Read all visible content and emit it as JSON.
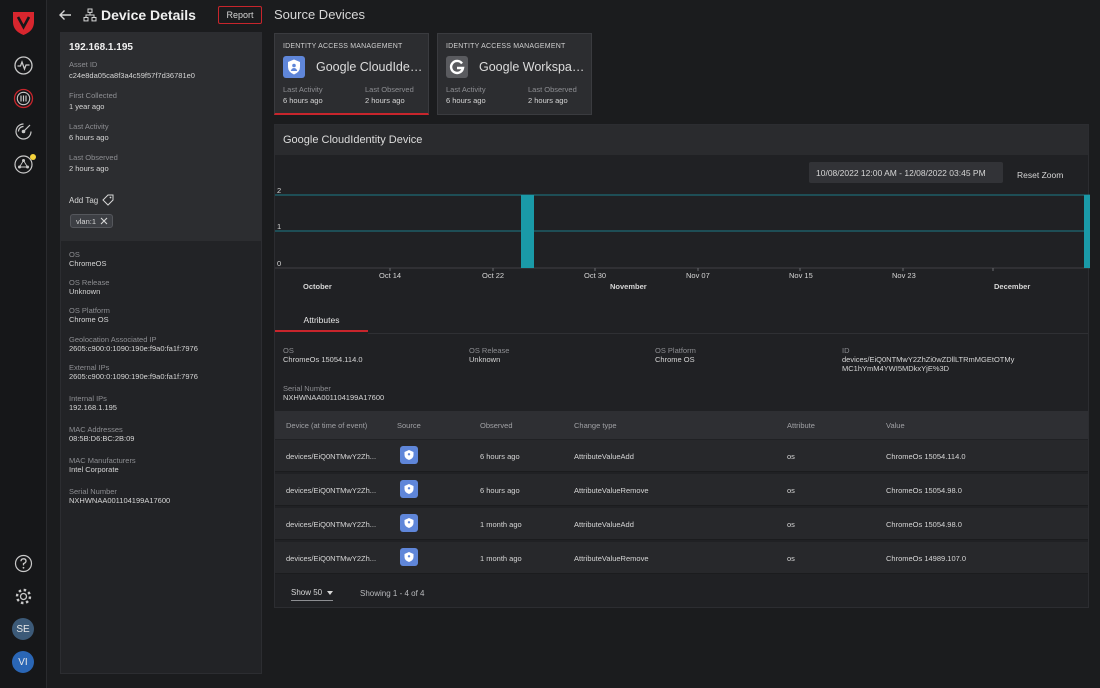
{
  "header": {
    "title": "Device Details",
    "report_label": "Report",
    "section_title": "Source Devices"
  },
  "device": {
    "ip": "192.168.1.195",
    "fields": [
      {
        "label": "Asset ID",
        "value": "c24e8da05ca8f3a4c59f57f7d36781e0"
      },
      {
        "label": "First Collected",
        "value": "1 year ago"
      },
      {
        "label": "Last Activity",
        "value": "6 hours ago"
      },
      {
        "label": "Last Observed",
        "value": "2 hours ago"
      }
    ],
    "add_tag_label": "Add Tag",
    "tag": "vlan:1",
    "details": [
      {
        "label": "OS",
        "value": "ChromeOS"
      },
      {
        "label": "OS Release",
        "value": "Unknown"
      },
      {
        "label": "OS Platform",
        "value": "Chrome OS"
      },
      {
        "label": "Geolocation Associated IP",
        "value": "2605:c900:0:1090:190e:f9a0:fa1f:7976"
      },
      {
        "label": "External IPs",
        "value": "2605:c900:0:1090:190e:f9a0:fa1f:7976"
      },
      {
        "label": "Internal IPs",
        "value": "192.168.1.195"
      },
      {
        "label": "MAC Addresses",
        "value": "08:5B:D6:BC:2B:09"
      },
      {
        "label": "MAC Manufacturers",
        "value": "Intel Corporate"
      },
      {
        "label": "Serial Number",
        "value": "NXHWNAA001104199A17600"
      }
    ]
  },
  "sources": [
    {
      "kind": "IDENTITY ACCESS MANAGEMENT",
      "name": "Google CloudIdentity Device",
      "last_activity_label": "Last Activity",
      "last_activity": "6 hours ago",
      "last_observed_label": "Last Observed",
      "last_observed": "2 hours ago",
      "icon": "shield-icon"
    },
    {
      "kind": "IDENTITY ACCESS MANAGEMENT",
      "name": "Google Workspace Device",
      "last_activity_label": "Last Activity",
      "last_activity": "6 hours ago",
      "last_observed_label": "Last Observed",
      "last_observed": "2 hours ago",
      "icon": "google-g-icon"
    }
  ],
  "main": {
    "title": "Google CloudIdentity Device",
    "date_range": "10/08/2022 12:00 AM - 12/08/2022 03:45 PM",
    "reset_zoom": "Reset Zoom",
    "tab": "Attributes",
    "attributes": [
      {
        "label": "OS",
        "value": "ChromeOs 15054.114.0"
      },
      {
        "label": "OS Release",
        "value": "Unknown"
      },
      {
        "label": "OS Platform",
        "value": "Chrome OS"
      },
      {
        "label": "ID",
        "value": "devices/EiQ0NTMwY2ZhZi0wZDllLTRmMGEtOTMyMC1hYmM4YWI5MDkxYjE%3D"
      },
      {
        "label": "Serial Number",
        "value": "NXHWNAA001104199A17600"
      }
    ],
    "table": {
      "columns": [
        "Device (at time of event)",
        "Source",
        "Observed",
        "Change type",
        "Attribute",
        "Value"
      ],
      "rows": [
        {
          "device": "devices/EiQ0NTMwY2Zh...",
          "observed": "6 hours ago",
          "change": "AttributeValueAdd",
          "attribute": "os",
          "value": "ChromeOs 15054.114.0"
        },
        {
          "device": "devices/EiQ0NTMwY2Zh...",
          "observed": "6 hours ago",
          "change": "AttributeValueRemove",
          "attribute": "os",
          "value": "ChromeOs 15054.98.0"
        },
        {
          "device": "devices/EiQ0NTMwY2Zh...",
          "observed": "1 month ago",
          "change": "AttributeValueAdd",
          "attribute": "os",
          "value": "ChromeOs 15054.98.0"
        },
        {
          "device": "devices/EiQ0NTMwY2Zh...",
          "observed": "1 month ago",
          "change": "AttributeValueRemove",
          "attribute": "os",
          "value": "ChromeOs 14989.107.0"
        }
      ]
    },
    "show_label": "Show 50",
    "showing": "Showing 1 - 4 of 4"
  },
  "chart_data": {
    "type": "bar",
    "x_tick_labels": [
      "Oct 14",
      "Oct 22",
      "Oct 30",
      "Nov 07",
      "Nov 15",
      "Nov 23"
    ],
    "month_labels": [
      "October",
      "November",
      "December"
    ],
    "y_tick_labels": [
      "0",
      "1",
      "2"
    ],
    "ylim": [
      0,
      2
    ],
    "x": [
      "Oct 25",
      "Dec 08"
    ],
    "values": [
      2,
      2
    ],
    "grid": true,
    "bar_color": "#1a9aa8"
  },
  "colors": {
    "accent": "#c8252c",
    "chart": "#1a9aa8",
    "source_icon": "#5f86d9"
  },
  "nav": {
    "icons": [
      "activity-icon",
      "assets-icon",
      "radar-icon",
      "network-icon",
      "help-icon",
      "settings-icon"
    ],
    "avatars": [
      "SE",
      "VI"
    ]
  }
}
